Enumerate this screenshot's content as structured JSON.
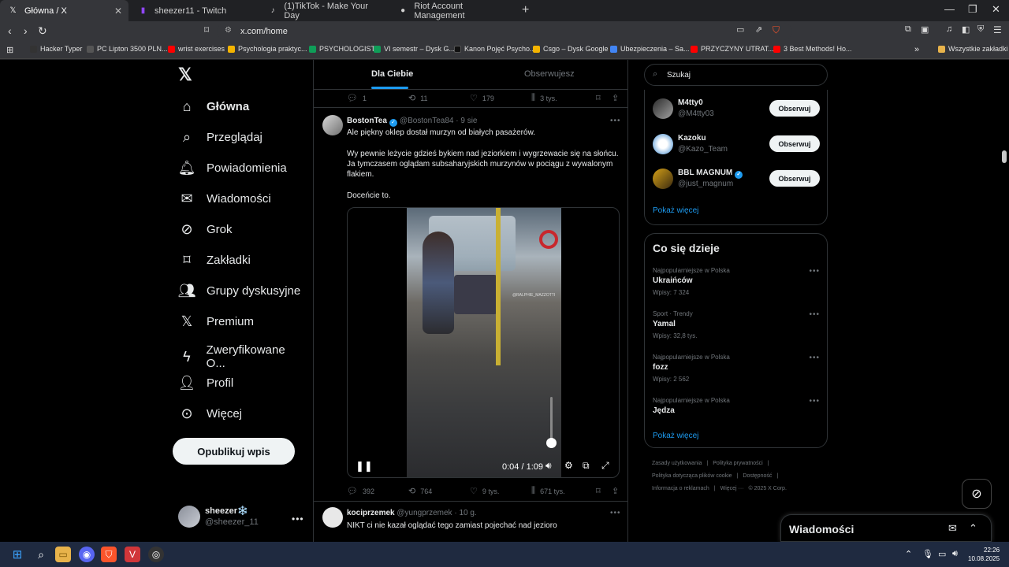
{
  "browser": {
    "tabs": [
      {
        "label": "Główna / X",
        "icon": "x-logo-icon"
      },
      {
        "label": "sheezer11 - Twitch",
        "icon": "twitch-icon"
      },
      {
        "label": "(1)TikTok - Make Your Day",
        "icon": "tiktok-icon"
      },
      {
        "label": "Riot Account Management",
        "icon": "riot-icon"
      }
    ],
    "address": "x.com/home",
    "bookmarks": [
      {
        "label": "Hacker Typer",
        "color": "#333333"
      },
      {
        "label": "PC Lipton 3500 PLN...",
        "color": "#555555"
      },
      {
        "label": "wrist exercises",
        "color": "#ff0000"
      },
      {
        "label": "Psychologia praktyc...",
        "color": "#f4b400"
      },
      {
        "label": "PSYCHOLOGIST",
        "color": "#0f9d58"
      },
      {
        "label": "VI semestr – Dysk G...",
        "color": "#0f9d58"
      },
      {
        "label": "Kanon Pojęć Psycho...",
        "color": "#111111"
      },
      {
        "label": "Csgo – Dysk Google",
        "color": "#f4b400"
      },
      {
        "label": "Ubezpieczenia – Sa...",
        "color": "#4285f4"
      },
      {
        "label": "PRZYCZYNY UTRAT...",
        "color": "#ff0000"
      },
      {
        "label": "3 Best Methods! Ho...",
        "color": "#ff0000"
      }
    ],
    "other_bookmarks": "Wszystkie zakładki"
  },
  "nav": {
    "items": [
      {
        "label": "Główna",
        "icon": "home-icon"
      },
      {
        "label": "Przeglądaj",
        "icon": "search-icon"
      },
      {
        "label": "Powiadomienia",
        "icon": "bell-icon"
      },
      {
        "label": "Wiadomości",
        "icon": "mail-icon"
      },
      {
        "label": "Grok",
        "icon": "grok-icon"
      },
      {
        "label": "Zakładki",
        "icon": "bookmark-icon"
      },
      {
        "label": "Grupy dyskusyjne",
        "icon": "people-icon"
      },
      {
        "label": "Premium",
        "icon": "x-logo-icon"
      },
      {
        "label": "Zweryfikowane O...",
        "icon": "lightning-icon"
      },
      {
        "label": "Profil",
        "icon": "person-icon"
      },
      {
        "label": "Więcej",
        "icon": "more-circle-icon"
      }
    ],
    "post_button": "Opublikuj wpis",
    "profile": {
      "name": "sheezer❄️",
      "handle": "@sheezer_11"
    }
  },
  "feed": {
    "tabs": [
      "Dla Ciebie",
      "Obserwujesz"
    ],
    "prev_actions": {
      "replies": "1",
      "reposts": "11",
      "likes": "179",
      "views": "3 tys."
    },
    "tweet": {
      "name": "BostonTea",
      "handle": "@BostonTea84",
      "time": "· 9 sie",
      "line1": "Ale piękny oklep dostał murzyn od białych pasażerów.",
      "line2": "Wy pewnie leżycie gdzieś bykiem nad jeziorkiem i wygrzewacie się na słońcu. Ja tymczasem oglądam subsaharyjskich murzynów w pociągu z wywalonym flakiem.",
      "line3": "Doceńcie to.",
      "video_time": "0:04 / 1:09",
      "video_watermark": "@RALPHIE_MAZZOTTI",
      "actions": {
        "replies": "392",
        "reposts": "764",
        "likes": "9 tys.",
        "views": "671 tys."
      }
    },
    "tweet2": {
      "name": "kociprzemek",
      "handle": "@yungprzemek",
      "time": "· 10 g.",
      "text": "NIKT ci nie kazał oglądać tego zamiast pojechać nad jezioro"
    }
  },
  "sidebar": {
    "search_placeholder": "Szukaj",
    "follow": [
      {
        "name": "M4tty0",
        "handle": "@M4tty03",
        "button": "Obserwuj",
        "verified": false
      },
      {
        "name": "Kazoku",
        "handle": "@Kazo_Team",
        "button": "Obserwuj",
        "verified": false
      },
      {
        "name": "BBL MAGNUM",
        "handle": "@just_magnum",
        "button": "Obserwuj",
        "verified": true
      }
    ],
    "show_more": "Pokaż więcej",
    "trends_title": "Co się dzieje",
    "trends": [
      {
        "context": "Najpopularniejsze w Polska",
        "name": "Ukraińców",
        "count": "Wpisy: 7 324"
      },
      {
        "context": "Sport · Trendy",
        "name": "Yamal",
        "count": "Wpisy: 32,8 tys."
      },
      {
        "context": "Najpopularniejsze w Polska",
        "name": "fozz",
        "count": "Wpisy: 2 562"
      },
      {
        "context": "Najpopularniejsze w Polska",
        "name": "Jędza",
        "count": ""
      }
    ],
    "trends_more": "Pokaż więcej",
    "footer": [
      "Zasady użytkowania",
      "Polityka prywatności",
      "Polityka dotycząca plików cookie",
      "Dostępność",
      "Informacja o reklamach",
      "Więcej ···",
      "© 2025 X Corp."
    ]
  },
  "messages_dock": "Wiadomości",
  "taskbar": {
    "time": "22:26",
    "date": "10.08.2025"
  }
}
